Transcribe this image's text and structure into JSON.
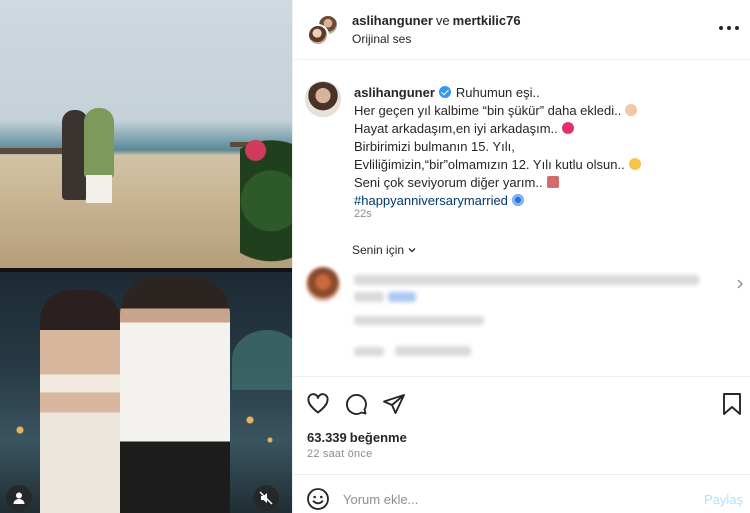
{
  "header": {
    "user1": "aslihanguner",
    "joiner": "ve",
    "user2": "mertkilic76",
    "audio": "Orijinal ses"
  },
  "caption": {
    "username": "aslihanguner",
    "lines": [
      "Ruhumun eşi..",
      "Her geçen yıl kalbime “bin şükür” daha ekledi..",
      "Hayat arkadaşım,en iyi arkadaşım..",
      "Birbirimizi bulmanın 15. Yılı,",
      "Evliliğimizin,“bir”olmamızın 12. Yılı kutlu olsun..",
      "Seni çok seviyorum diğer yarım..",
      "#happyanniversarymarried"
    ],
    "time": "22s"
  },
  "comments_section": {
    "for_you": "Senin için"
  },
  "engagement": {
    "likes_count": "63.339",
    "likes_label": "beğenme",
    "posted_ago": "22 saat önce"
  },
  "composer": {
    "placeholder": "Yorum ekle...",
    "post_label": "Paylaş"
  },
  "colors": {
    "link": "#00376b",
    "verified": "#3897f0",
    "post_disabled": "#b2dffc",
    "meta_gray": "#8e8e8e"
  }
}
